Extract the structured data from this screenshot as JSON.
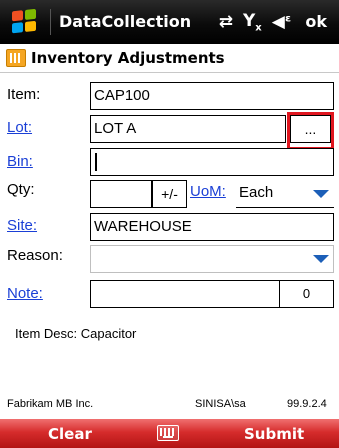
{
  "statusbar": {
    "app_title": "DataCollection",
    "icons": [
      "windows-start-icon",
      "sync-icon",
      "signal-icon",
      "volume-icon"
    ],
    "ok_label": "ok"
  },
  "form": {
    "title": "Inventory Adjustments",
    "item": {
      "label": "Item:",
      "value": "CAP100"
    },
    "lot": {
      "label": "Lot:",
      "value": "LOT A",
      "lookup_label": "..."
    },
    "bin": {
      "label": "Bin:",
      "value": ""
    },
    "qty": {
      "label": "Qty:",
      "value": "",
      "sign_label": "+/-"
    },
    "uom": {
      "label": "UoM:",
      "value": "Each"
    },
    "site": {
      "label": "Site:",
      "value": "WAREHOUSE"
    },
    "reason": {
      "label": "Reason:",
      "value": ""
    },
    "note": {
      "label": "Note:",
      "value": "",
      "count": "0"
    },
    "item_desc": "Item Desc: Capacitor"
  },
  "footer": {
    "company": "Fabrikam MB Inc.",
    "user": "SINISA\\sa",
    "version": "99.9.2.4"
  },
  "softkeys": {
    "left": "Clear",
    "right": "Submit"
  },
  "colors": {
    "link": "#1a3fd6",
    "highlight": "#e0161f",
    "softbar": "#d62c2c",
    "select_arrow": "#1c5fb8"
  }
}
